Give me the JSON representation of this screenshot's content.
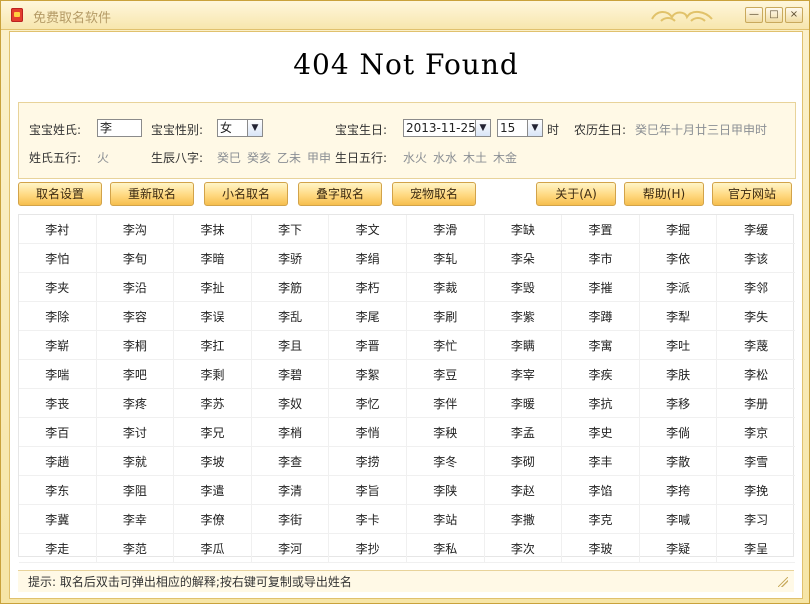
{
  "window": {
    "title": "免费取名软件",
    "controls": {
      "min": "—",
      "max": "□",
      "close": "×"
    }
  },
  "header": {
    "title": "404 Not Found"
  },
  "form": {
    "surname_label": "宝宝姓氏:",
    "surname_value": "李",
    "gender_label": "宝宝性别:",
    "gender_value": "女",
    "birth_label": "宝宝生日:",
    "birth_date_value": "2013-11-25",
    "birth_hour_value": "15",
    "hour_unit": "时",
    "lunar_label": "农历生日:",
    "lunar_value": "癸巳年十月廿三日甲申时",
    "surname_wuxing_label": "姓氏五行:",
    "surname_wuxing_value": "火",
    "bazi_label": "生辰八字:",
    "bazi_values": [
      "癸巳",
      "癸亥",
      "乙未",
      "甲申"
    ],
    "birth_wuxing_label": "生日五行:",
    "birth_wuxing_values": [
      "水火",
      "水水",
      "木土",
      "木金"
    ]
  },
  "toolbar": {
    "buttons": [
      "取名设置",
      "重新取名",
      "小名取名",
      "叠字取名",
      "宠物取名",
      "关于(A)",
      "帮助(H)",
      "官方网站"
    ]
  },
  "names": [
    [
      "李衬",
      "李沟",
      "李抹",
      "李下",
      "李文",
      "李滑",
      "李缺",
      "李置",
      "李掘",
      "李缓"
    ],
    [
      "李怕",
      "李旬",
      "李暗",
      "李骄",
      "李绢",
      "李轧",
      "李朵",
      "李市",
      "李依",
      "李该"
    ],
    [
      "李夹",
      "李沿",
      "李扯",
      "李筋",
      "李朽",
      "李裁",
      "李毁",
      "李摧",
      "李派",
      "李邻"
    ],
    [
      "李除",
      "李容",
      "李误",
      "李乱",
      "李尾",
      "李刷",
      "李紫",
      "李蹲",
      "李犁",
      "李失"
    ],
    [
      "李崭",
      "李桐",
      "李扛",
      "李且",
      "李晋",
      "李忙",
      "李瞒",
      "李寓",
      "李吐",
      "李蔑"
    ],
    [
      "李喘",
      "李吧",
      "李剩",
      "李碧",
      "李絮",
      "李豆",
      "李宰",
      "李疾",
      "李肤",
      "李松"
    ],
    [
      "李丧",
      "李疼",
      "李苏",
      "李奴",
      "李忆",
      "李伴",
      "李暖",
      "李抗",
      "李移",
      "李册"
    ],
    [
      "李百",
      "李讨",
      "李兄",
      "李梢",
      "李悄",
      "李秧",
      "李孟",
      "李史",
      "李倘",
      "李京"
    ],
    [
      "李趟",
      "李就",
      "李坡",
      "李查",
      "李捞",
      "李冬",
      "李砌",
      "李丰",
      "李散",
      "李雪"
    ],
    [
      "李东",
      "李阻",
      "李遣",
      "李清",
      "李旨",
      "李陕",
      "李赵",
      "李馅",
      "李挎",
      "李挽"
    ],
    [
      "李冀",
      "李幸",
      "李僚",
      "李街",
      "李卡",
      "李站",
      "李撒",
      "李克",
      "李喊",
      "李习"
    ],
    [
      "李走",
      "李范",
      "李瓜",
      "李河",
      "李抄",
      "李私",
      "李次",
      "李玻",
      "李疑",
      "李呈"
    ]
  ],
  "status": {
    "text": "提示:   取名后双击可弹出相应的解释;按右键可复制或导出姓名"
  },
  "colors": {
    "window_bg": "#f6e5a6",
    "button_gold": "#ffd981",
    "accent_border": "#d2a34a",
    "muted_text": "#8b8f94"
  }
}
